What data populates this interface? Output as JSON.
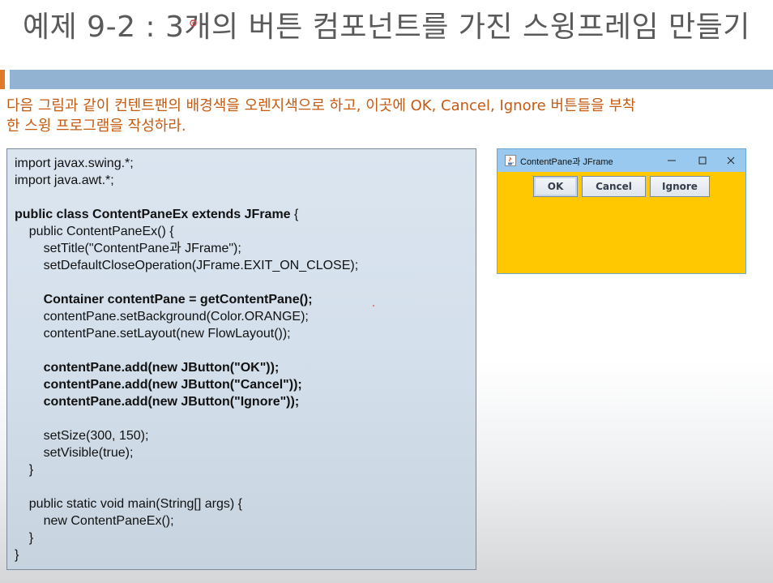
{
  "slide": {
    "title": "예제 9-2 : 3개의 버튼 컴포넌트를 가진 스윙프레임 만들기",
    "instruction_line1": "다음 그림과 같이 컨텐트팬의 배경색을 오렌지색으로 하고, 이곳에 OK, Cancel, Ignore 버튼들을 부착",
    "instruction_line2": "한 스윙 프로그램을 작성하라."
  },
  "code": {
    "lines": [
      {
        "text": "import javax.swing.*;",
        "bold": false
      },
      {
        "text": "import java.awt.*;",
        "bold": false
      },
      {
        "text": "",
        "bold": false
      },
      {
        "text": "public class ContentPaneEx extends JFrame {",
        "bold": "partial"
      },
      {
        "text": "    public ContentPaneEx() {",
        "bold": false
      },
      {
        "text": "        setTitle(\"ContentPane과 JFrame\");",
        "bold": false
      },
      {
        "text": "        setDefaultCloseOperation(JFrame.EXIT_ON_CLOSE);",
        "bold": false
      },
      {
        "text": "",
        "bold": false
      },
      {
        "text": "        Container contentPane = getContentPane();",
        "bold": true
      },
      {
        "text": "        contentPane.setBackground(Color.ORANGE);",
        "bold": false
      },
      {
        "text": "        contentPane.setLayout(new FlowLayout());",
        "bold": false
      },
      {
        "text": "",
        "bold": false
      },
      {
        "text": "        contentPane.add(new JButton(\"OK\"));",
        "bold": true
      },
      {
        "text": "        contentPane.add(new JButton(\"Cancel\"));",
        "bold": true
      },
      {
        "text": "        contentPane.add(new JButton(\"Ignore\"));",
        "bold": true
      },
      {
        "text": "",
        "bold": false
      },
      {
        "text": "        setSize(300, 150);",
        "bold": false
      },
      {
        "text": "        setVisible(true);",
        "bold": false
      },
      {
        "text": "    }",
        "bold": false
      },
      {
        "text": "",
        "bold": false
      },
      {
        "text": "    public static void main(String[] args) {",
        "bold": false
      },
      {
        "text": "        new ContentPaneEx();",
        "bold": false
      },
      {
        "text": "    }",
        "bold": false
      },
      {
        "text": "}",
        "bold": false
      }
    ]
  },
  "swing_window": {
    "title": "ContentPane과 JFrame",
    "app_icon": "java-icon",
    "controls": [
      "minimize-icon",
      "maximize-icon",
      "close-icon"
    ],
    "background_color": "#ffc800",
    "buttons": {
      "ok": "OK",
      "cancel": "Cancel",
      "ignore": "Ignore"
    }
  },
  "colors": {
    "title_text": "#5a5a5a",
    "instruction_text": "#c55a11",
    "bar": "#93b3d3",
    "accent": "#e07a2a"
  }
}
